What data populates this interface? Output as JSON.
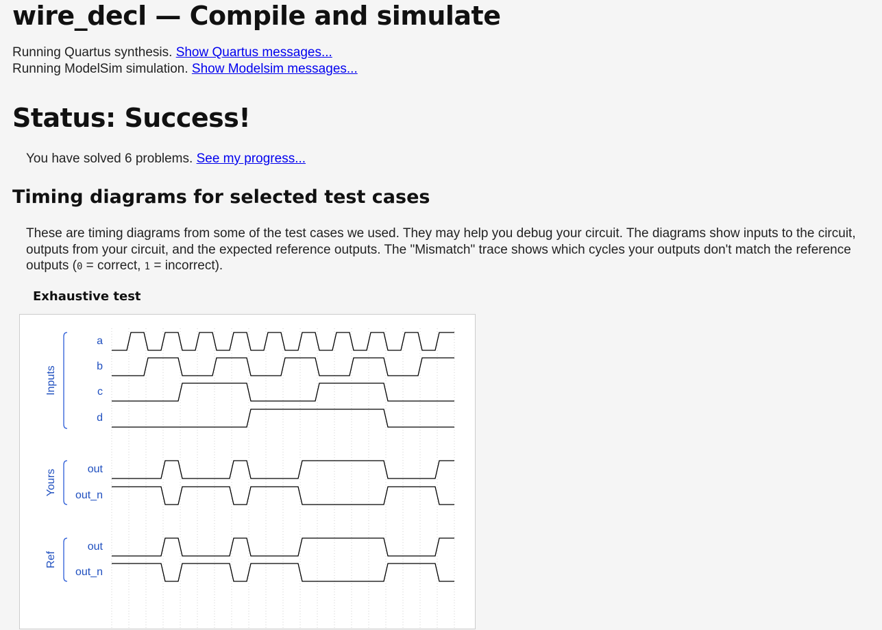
{
  "header": {
    "title": "wire_decl — Compile and simulate"
  },
  "run": {
    "quartus_text": "Running Quartus synthesis.",
    "quartus_link": "Show Quartus messages...",
    "modelsim_text": "Running ModelSim simulation.",
    "modelsim_link": "Show Modelsim messages..."
  },
  "status": {
    "heading": "Status: Success!"
  },
  "progress": {
    "text": "You have solved 6 problems.",
    "link": "See my progress..."
  },
  "timing": {
    "heading": "Timing diagrams for selected test cases",
    "desc_1": "These are timing diagrams from some of the test cases we used. They may help you debug your circuit. The diagrams show inputs to the circuit, outputs from your circuit, and the expected reference outputs. The \"Mismatch\" trace shows which cycles your outputs don't match the reference outputs (",
    "code_0": "0",
    "desc_2": " = correct, ",
    "code_1": "1",
    "desc_3": " = incorrect).",
    "test_name": "Exhaustive test"
  },
  "waveform": {
    "groups": [
      {
        "name": "Inputs",
        "signals": [
          "a",
          "b",
          "c",
          "d"
        ]
      },
      {
        "name": "Yours",
        "signals": [
          "out",
          "out_n"
        ]
      },
      {
        "name": "Ref",
        "signals": [
          "out",
          "out_n"
        ]
      }
    ],
    "traces": [
      {
        "group": "Inputs",
        "name": "a",
        "values": [
          0,
          1,
          0,
          1,
          0,
          1,
          0,
          1,
          0,
          1,
          0,
          1,
          0,
          1,
          0,
          1,
          0,
          1,
          0,
          1
        ]
      },
      {
        "group": "Inputs",
        "name": "b",
        "values": [
          0,
          0,
          1,
          1,
          0,
          0,
          1,
          1,
          0,
          0,
          1,
          1,
          0,
          0,
          1,
          1,
          0,
          0,
          1,
          1
        ]
      },
      {
        "group": "Inputs",
        "name": "c",
        "values": [
          0,
          0,
          0,
          0,
          1,
          1,
          1,
          1,
          0,
          0,
          0,
          0,
          1,
          1,
          1,
          1,
          0,
          0,
          0,
          0
        ]
      },
      {
        "group": "Inputs",
        "name": "d",
        "values": [
          0,
          0,
          0,
          0,
          0,
          0,
          0,
          0,
          1,
          1,
          1,
          1,
          1,
          1,
          1,
          1,
          0,
          0,
          0,
          0
        ]
      },
      {
        "group": "Yours",
        "name": "out",
        "values": [
          0,
          0,
          0,
          1,
          0,
          0,
          0,
          1,
          0,
          0,
          0,
          1,
          1,
          1,
          1,
          1,
          0,
          0,
          0,
          1
        ]
      },
      {
        "group": "Yours",
        "name": "out_n",
        "values": [
          1,
          1,
          1,
          0,
          1,
          1,
          1,
          0,
          1,
          1,
          1,
          0,
          0,
          0,
          0,
          0,
          1,
          1,
          1,
          0
        ]
      },
      {
        "group": "Ref",
        "name": "out",
        "values": [
          0,
          0,
          0,
          1,
          0,
          0,
          0,
          1,
          0,
          0,
          0,
          1,
          1,
          1,
          1,
          1,
          0,
          0,
          0,
          1
        ]
      },
      {
        "group": "Ref",
        "name": "out_n",
        "values": [
          1,
          1,
          1,
          0,
          1,
          1,
          1,
          0,
          1,
          1,
          1,
          0,
          0,
          0,
          0,
          0,
          1,
          1,
          1,
          0
        ]
      }
    ],
    "colors": {
      "trace": "#000000",
      "label": "#1f4fbf",
      "bracket": "#2a5bd7",
      "grid": "#cfcfcf"
    }
  }
}
